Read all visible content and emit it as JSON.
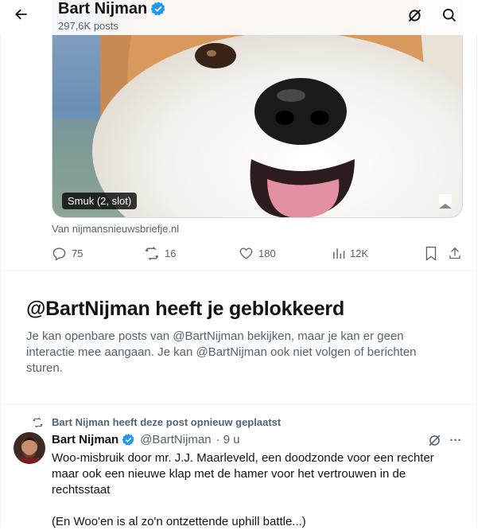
{
  "header": {
    "name": "Bart Nijman",
    "post_count": "297,6K posts"
  },
  "media": {
    "alt_badge": "Smuk (2, slot)",
    "source": "Van nijmansnieuwsbriefje.nl"
  },
  "actions": {
    "replies": "75",
    "reposts": "16",
    "likes": "180",
    "views": "12K"
  },
  "blocked": {
    "title": "@BartNijman heeft je geblokkeerd",
    "description": "Je kan openbare posts van @BartNijman bekijken, maar je kan er geen interactie mee aangaan. Je kan @BartNijman ook niet volgen of berichten sturen."
  },
  "tweet": {
    "repost_label": "Bart Nijman heeft deze post opnieuw geplaatst",
    "name": "Bart Nijman",
    "handle": "@BartNijman",
    "time": "· 9 u",
    "more": "···",
    "text_line1": "Woo-misbruik door mr. J.J. Maarleveld, een doodzonde voor een rechter maar ook een nieuwe klap met de hamer voor het vertrouwen in de rechtsstaat",
    "text_line2": "(En Woo'en is al zo'n ontzettende uphill battle...)"
  },
  "colors": {
    "verified": "#1d9bf0",
    "secondary_text": "#536471",
    "border": "#eff3f4"
  }
}
